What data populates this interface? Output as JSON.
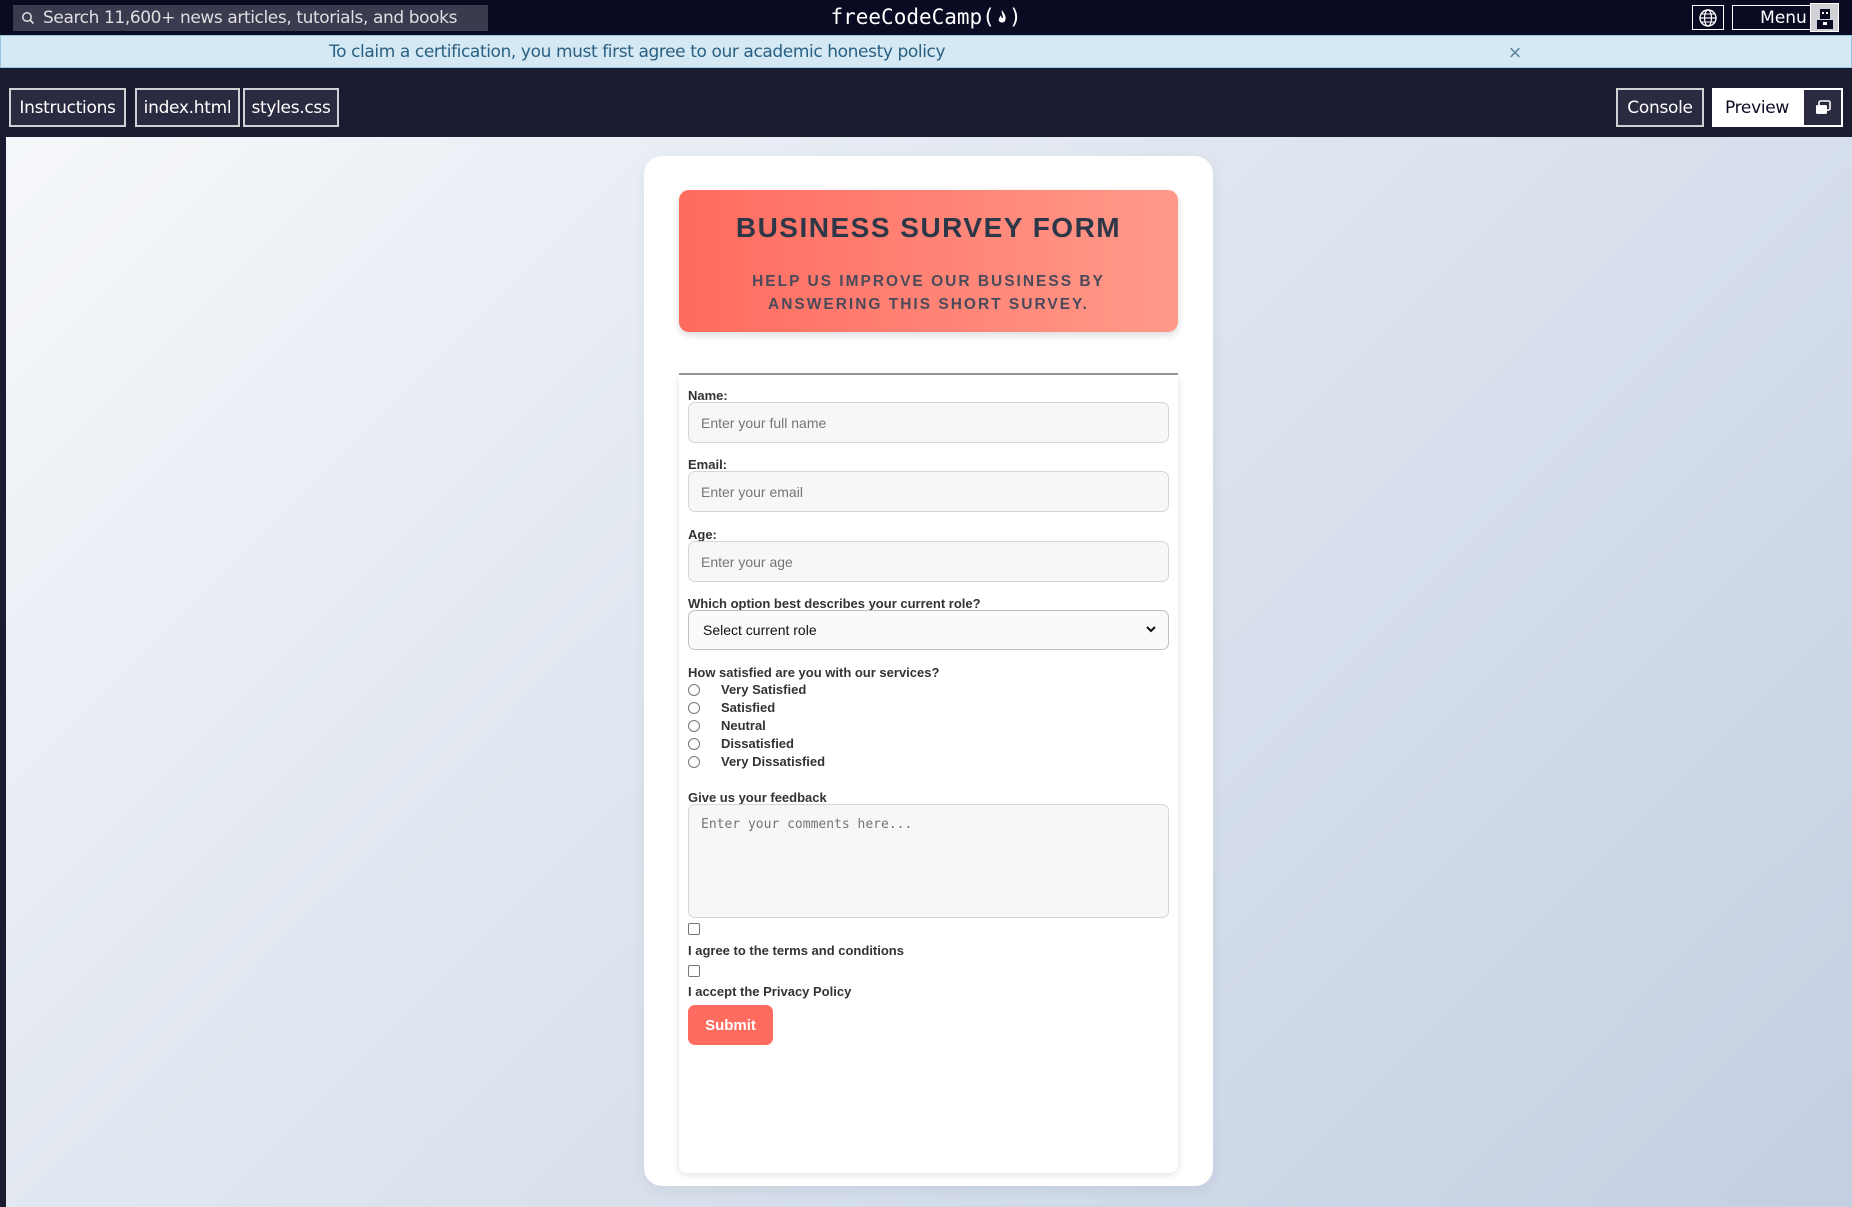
{
  "topnav": {
    "search_placeholder": "Search 11,600+ news articles, tutorials, and books",
    "logo_text": "freeCodeCamp",
    "menu_label": "Menu",
    "icons": [
      "search-icon",
      "globe-icon",
      "flame-icon",
      "avatar-icon"
    ]
  },
  "banner": {
    "text": "To claim a certification, you must first agree to our academic honesty policy",
    "close_icon": "×"
  },
  "tabs": {
    "instructions": "Instructions",
    "index": "index.html",
    "styles": "styles.css",
    "console": "Console",
    "preview": "Preview"
  },
  "survey": {
    "title": "BUSINESS SURVEY FORM",
    "subtitle": "Help us improve our business by answering this short survey.",
    "fields": {
      "name_label": "Name:",
      "name_placeholder": "Enter your full name",
      "email_label": "Email:",
      "email_placeholder": "Enter your email",
      "age_label": "Age:",
      "age_placeholder": "Enter your age",
      "role_label": "Which option best describes your current role?",
      "role_selected": "Select current role"
    },
    "satisfaction": {
      "question": "How satisfied are you with our services?",
      "options": [
        "Very Satisfied",
        "Satisfied",
        "Neutral",
        "Dissatisfied",
        "Very Dissatisfied"
      ]
    },
    "feedback": {
      "label": "Give us your feedback",
      "placeholder": "Enter your comments here..."
    },
    "agreements": {
      "terms": "I agree to the terms and conditions",
      "privacy": "I accept the Privacy Policy"
    },
    "submit_label": "Submit"
  },
  "colors": {
    "nav_bg": "#0a0a23",
    "banner_bg": "#d4e9f3",
    "accent": "#ff6b5e",
    "header_gradient_end": "#ff9a8b"
  }
}
